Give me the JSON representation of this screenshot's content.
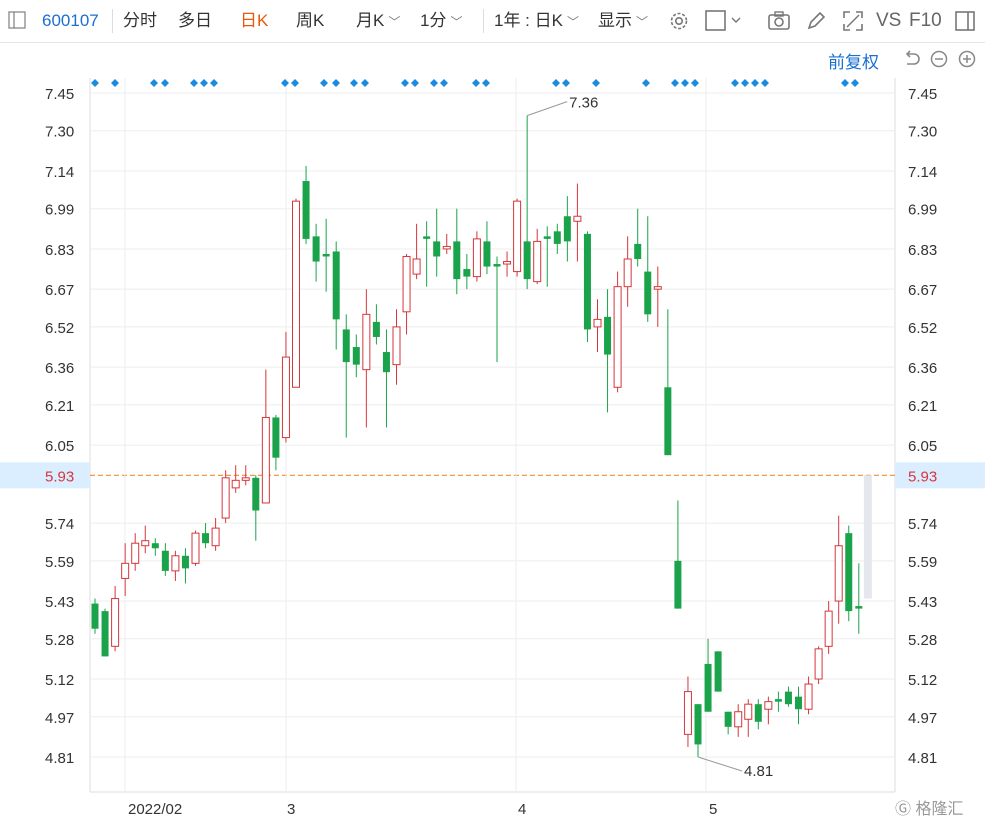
{
  "toolbar": {
    "stock_code": "600107",
    "tabs": [
      "分时",
      "多日",
      "日K",
      "周K",
      "月K"
    ],
    "active_tab": "日K",
    "interval": "1分",
    "range": "1年 : 日K",
    "display": "显示",
    "vs": "VS",
    "f10": "F10"
  },
  "controls": {
    "adjust": "前复权"
  },
  "colors": {
    "up": "#d6363a",
    "down": "#1aa34a",
    "accent": "#1a6fd1",
    "active": "#e8590c",
    "ref": "#f08c2e"
  },
  "chart_data": {
    "type": "candlestick",
    "y_ticks": [
      "7.45",
      "7.30",
      "7.14",
      "6.99",
      "6.83",
      "6.67",
      "6.52",
      "6.36",
      "6.21",
      "6.05",
      "5.93",
      "5.74",
      "5.59",
      "5.43",
      "5.28",
      "5.12",
      "4.97",
      "4.81"
    ],
    "ylim": [
      4.72,
      7.52
    ],
    "x_labels": [
      "2022/02",
      "3",
      "4",
      "5"
    ],
    "current_price": "5.93",
    "annotations": {
      "high": "7.36",
      "low": "4.81"
    },
    "candles": [
      [
        5.42,
        5.32,
        5.44,
        5.3
      ],
      [
        5.39,
        5.21,
        5.4,
        5.21
      ],
      [
        5.25,
        5.44,
        5.49,
        5.23
      ],
      [
        5.52,
        5.58,
        5.66,
        5.45
      ],
      [
        5.58,
        5.66,
        5.7,
        5.55
      ],
      [
        5.65,
        5.67,
        5.73,
        5.62
      ],
      [
        5.66,
        5.64,
        5.68,
        5.61
      ],
      [
        5.63,
        5.55,
        5.66,
        5.53
      ],
      [
        5.55,
        5.61,
        5.63,
        5.51
      ],
      [
        5.61,
        5.56,
        5.64,
        5.5
      ],
      [
        5.58,
        5.7,
        5.71,
        5.57
      ],
      [
        5.7,
        5.66,
        5.74,
        5.64
      ],
      [
        5.65,
        5.72,
        5.76,
        5.63
      ],
      [
        5.76,
        5.92,
        5.95,
        5.74
      ],
      [
        5.88,
        5.91,
        5.97,
        5.86
      ],
      [
        5.91,
        5.92,
        5.97,
        5.89
      ],
      [
        5.92,
        5.79,
        5.93,
        5.67
      ],
      [
        5.82,
        6.16,
        6.35,
        5.82
      ],
      [
        6.16,
        6.0,
        6.17,
        5.95
      ],
      [
        6.08,
        6.4,
        6.5,
        6.06
      ],
      [
        6.28,
        7.02,
        7.03,
        6.28
      ],
      [
        7.1,
        6.87,
        7.16,
        6.85
      ],
      [
        6.88,
        6.78,
        6.93,
        6.7
      ],
      [
        6.81,
        6.8,
        6.95,
        6.66
      ],
      [
        6.82,
        6.55,
        6.86,
        6.43
      ],
      [
        6.51,
        6.38,
        6.57,
        6.08
      ],
      [
        6.44,
        6.37,
        6.49,
        6.32
      ],
      [
        6.35,
        6.57,
        6.67,
        6.12
      ],
      [
        6.54,
        6.48,
        6.61,
        6.45
      ],
      [
        6.42,
        6.34,
        6.51,
        6.12
      ],
      [
        6.37,
        6.52,
        6.59,
        6.29
      ],
      [
        6.58,
        6.8,
        6.81,
        6.49
      ],
      [
        6.73,
        6.79,
        6.93,
        6.71
      ],
      [
        6.88,
        6.87,
        6.94,
        6.68
      ],
      [
        6.86,
        6.8,
        6.99,
        6.72
      ],
      [
        6.83,
        6.84,
        6.89,
        6.81
      ],
      [
        6.86,
        6.71,
        6.99,
        6.65
      ],
      [
        6.75,
        6.72,
        6.81,
        6.67
      ],
      [
        6.72,
        6.87,
        6.9,
        6.7
      ],
      [
        6.86,
        6.76,
        6.94,
        6.73
      ],
      [
        6.77,
        6.76,
        6.8,
        6.38
      ],
      [
        6.77,
        6.78,
        6.82,
        6.72
      ],
      [
        6.74,
        7.02,
        7.03,
        6.72
      ],
      [
        6.86,
        6.71,
        7.36,
        6.67
      ],
      [
        6.7,
        6.86,
        6.91,
        6.69
      ],
      [
        6.88,
        6.87,
        6.92,
        6.68
      ],
      [
        6.9,
        6.85,
        6.93,
        6.81
      ],
      [
        6.96,
        6.86,
        7.04,
        6.78
      ],
      [
        6.94,
        6.96,
        7.09,
        6.78
      ],
      [
        6.89,
        6.51,
        6.9,
        6.46
      ],
      [
        6.52,
        6.55,
        6.63,
        6.42
      ],
      [
        6.56,
        6.41,
        6.67,
        6.18
      ],
      [
        6.28,
        6.68,
        6.74,
        6.26
      ],
      [
        6.68,
        6.79,
        6.88,
        6.6
      ],
      [
        6.85,
        6.79,
        6.99,
        6.76
      ],
      [
        6.74,
        6.57,
        6.96,
        6.54
      ],
      [
        6.67,
        6.68,
        6.76,
        6.52
      ],
      [
        6.28,
        6.01,
        6.59,
        6.01
      ],
      [
        5.59,
        5.4,
        5.83,
        5.4
      ],
      [
        4.9,
        5.07,
        5.13,
        4.85
      ],
      [
        5.02,
        4.86,
        5.02,
        4.81
      ],
      [
        5.18,
        4.99,
        5.28,
        4.99
      ],
      [
        5.23,
        5.07,
        5.23,
        5.07
      ],
      [
        4.99,
        4.93,
        4.99,
        4.9
      ],
      [
        4.93,
        4.99,
        5.02,
        4.89
      ],
      [
        4.96,
        5.02,
        5.04,
        4.89
      ],
      [
        5.02,
        4.95,
        5.04,
        4.92
      ],
      [
        5.0,
        5.03,
        5.05,
        4.94
      ],
      [
        5.04,
        5.03,
        5.07,
        4.99
      ],
      [
        5.07,
        5.02,
        5.09,
        5.01
      ],
      [
        5.05,
        5.0,
        5.09,
        4.94
      ],
      [
        5.0,
        5.1,
        5.13,
        4.98
      ],
      [
        5.12,
        5.24,
        5.25,
        5.1
      ],
      [
        5.25,
        5.39,
        5.43,
        5.22
      ],
      [
        5.43,
        5.65,
        5.77,
        5.34
      ],
      [
        5.7,
        5.39,
        5.73,
        5.35
      ],
      [
        5.41,
        5.4,
        5.58,
        5.3
      ]
    ],
    "projection": [
      5.44,
      5.93
    ],
    "dot_groups": [
      [
        95,
        115
      ],
      [
        154,
        165
      ],
      [
        194,
        204,
        214
      ],
      [
        285,
        295
      ],
      [
        324,
        336
      ],
      [
        354,
        365
      ],
      [
        405,
        415
      ],
      [
        434,
        444
      ],
      [
        476,
        486
      ],
      [
        556,
        566
      ],
      [
        596
      ],
      [
        646
      ],
      [
        675,
        685,
        695
      ],
      [
        735,
        745,
        755,
        765
      ],
      [
        845,
        855
      ]
    ]
  }
}
